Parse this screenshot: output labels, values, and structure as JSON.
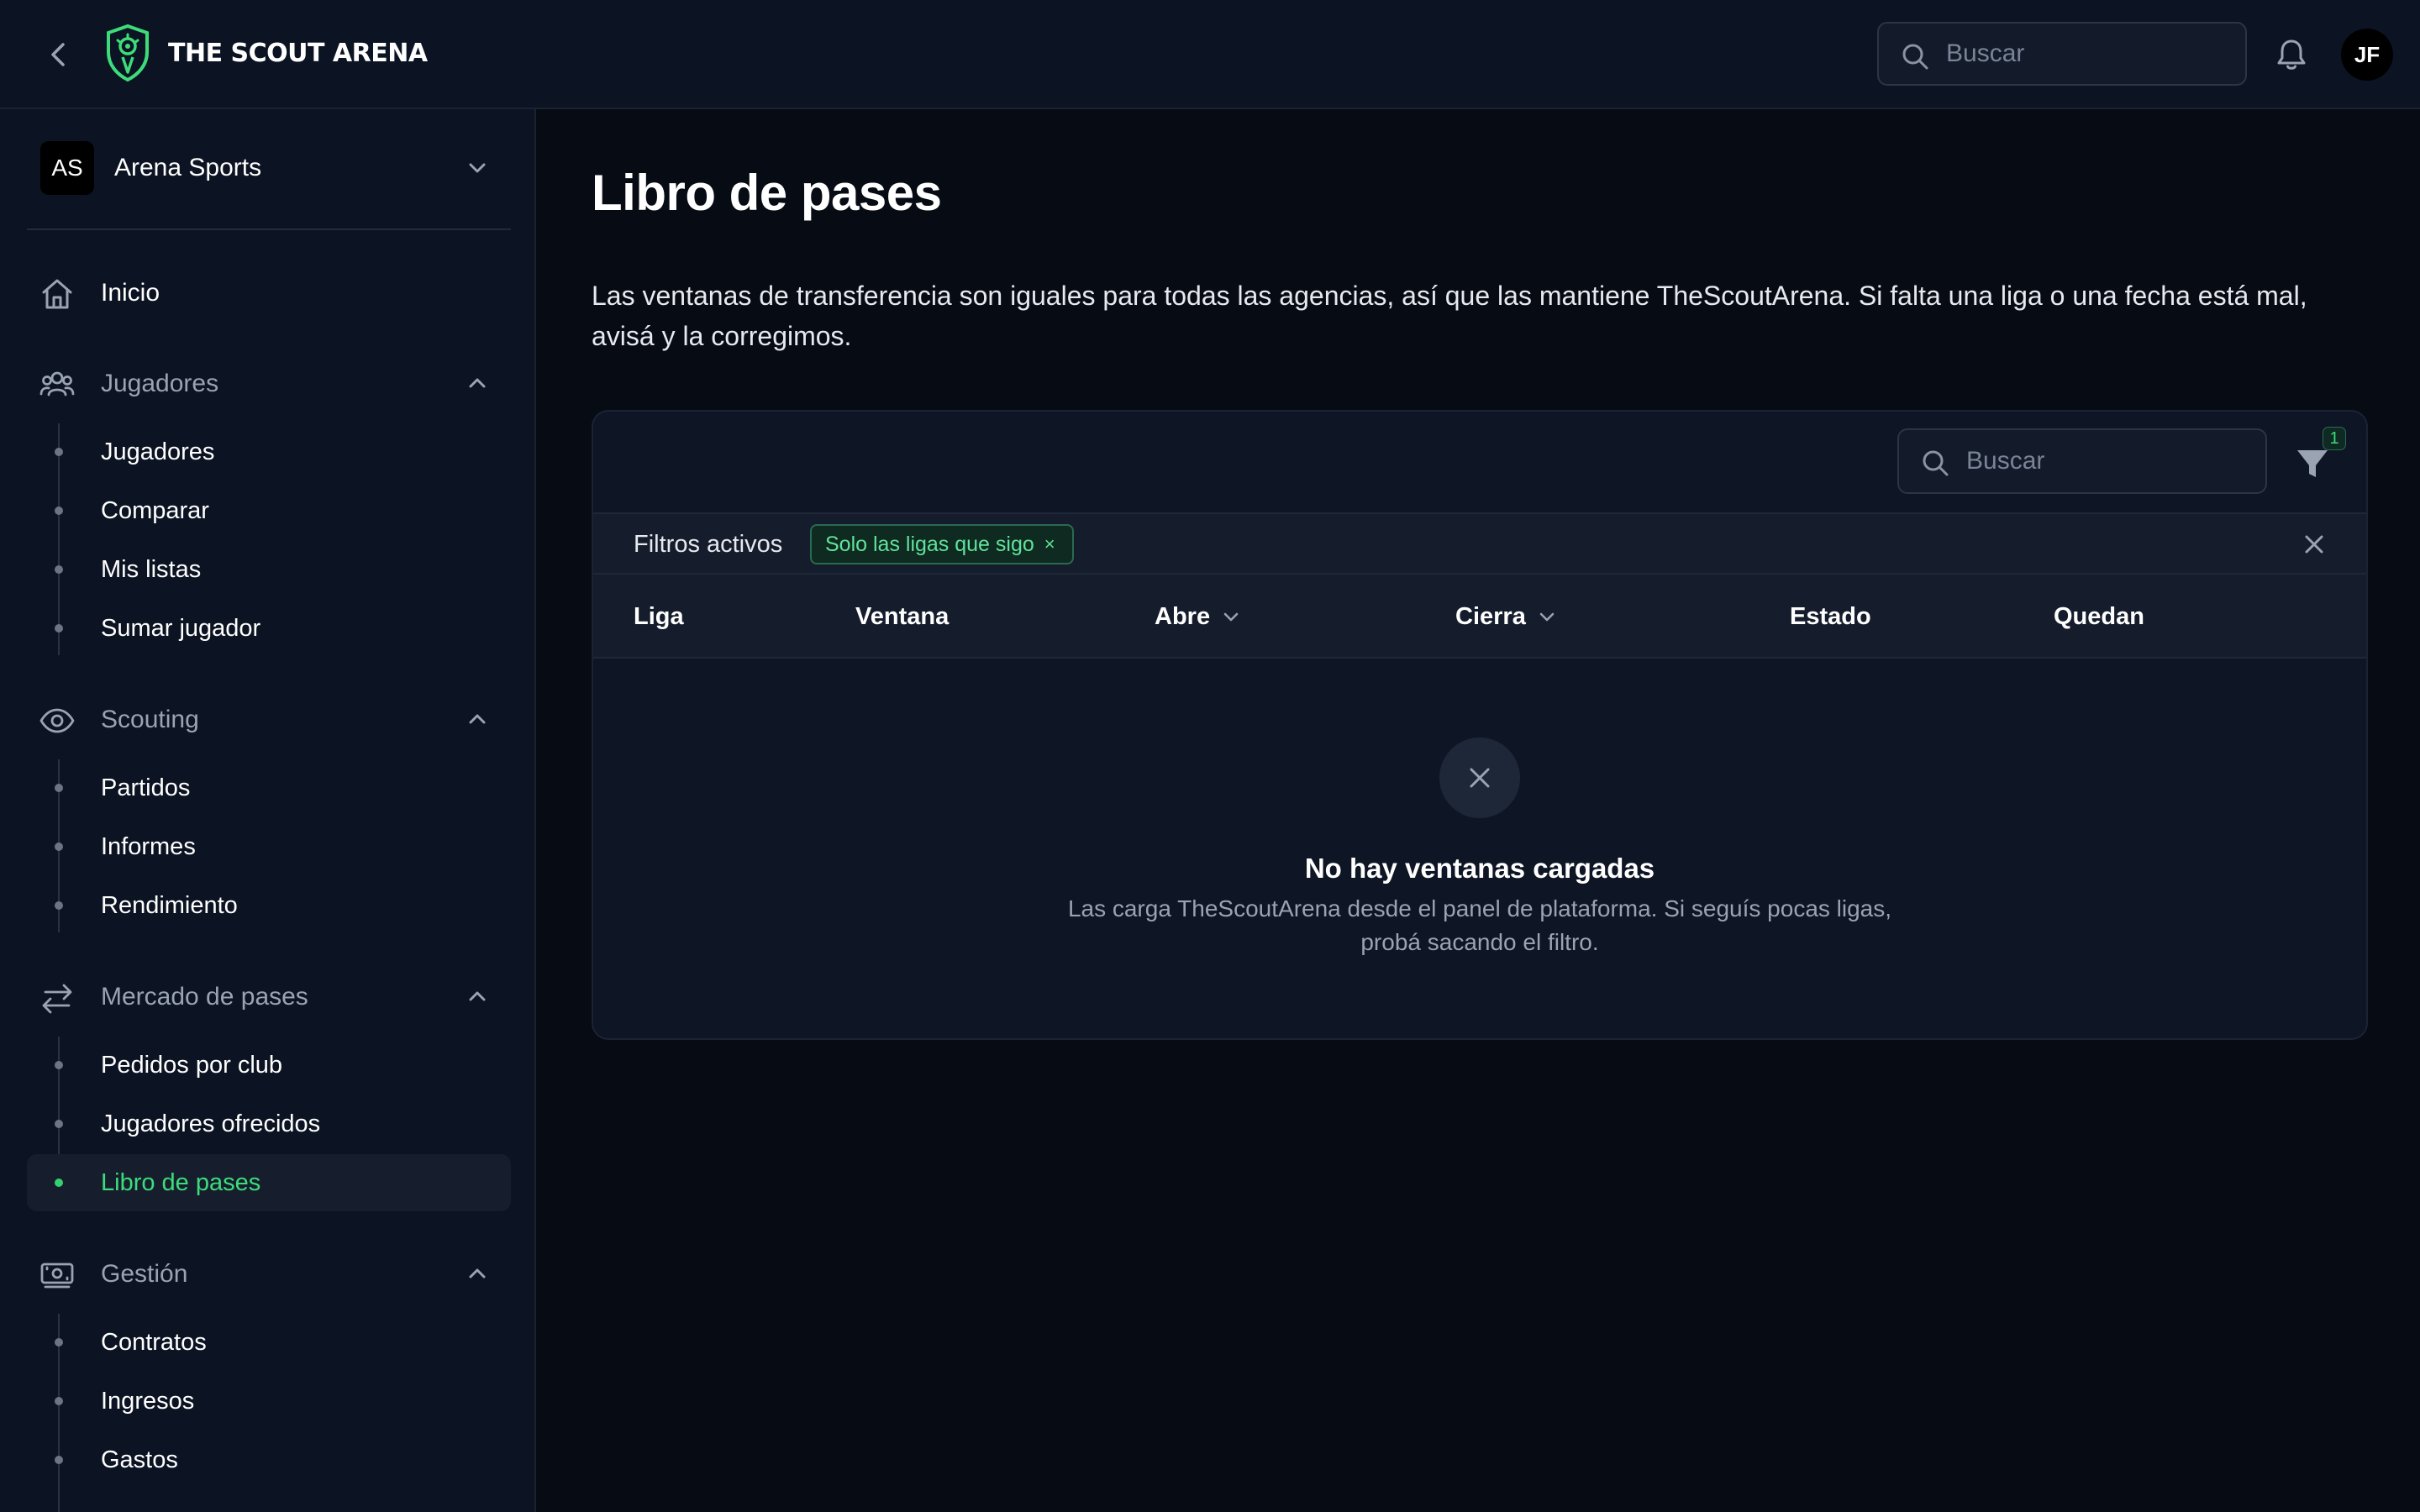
{
  "header": {
    "brand": "THE SCOUT ARENA",
    "search_placeholder": "Buscar",
    "user_initials": "JF"
  },
  "sidebar": {
    "org": {
      "initials": "AS",
      "name": "Arena Sports"
    },
    "home": "Inicio",
    "groups": [
      {
        "label": "Jugadores",
        "items": [
          "Jugadores",
          "Comparar",
          "Mis listas",
          "Sumar jugador"
        ]
      },
      {
        "label": "Scouting",
        "items": [
          "Partidos",
          "Informes",
          "Rendimiento"
        ]
      },
      {
        "label": "Mercado de pases",
        "items": [
          "Pedidos por club",
          "Jugadores ofrecidos",
          "Libro de pases"
        ]
      },
      {
        "label": "Gestión",
        "items": [
          "Contratos",
          "Ingresos",
          "Gastos"
        ]
      }
    ],
    "active_item": "Libro de pases"
  },
  "main": {
    "title": "Libro de pases",
    "description": "Las ventanas de transferencia son iguales para todas las agencias, así que las mantiene TheScoutArena. Si falta una liga o una fecha está mal, avisá y la corregimos.",
    "search_placeholder": "Buscar",
    "filter_count": "1",
    "active_filters_label": "Filtros activos",
    "active_filter_chip": "Solo las ligas que sigo",
    "chip_remove": "×",
    "columns": [
      "Liga",
      "Ventana",
      "Abre",
      "Cierra",
      "Estado",
      "Quedan"
    ],
    "empty": {
      "title": "No hay ventanas cargadas",
      "description": "Las carga TheScoutArena desde el panel de plataforma. Si seguís pocas ligas, probá sacando el filtro."
    }
  },
  "colors": {
    "background": "#060b14",
    "panel": "#0c1322",
    "accent": "#3ddc7a",
    "muted_text": "#9aa3b2"
  },
  "icons": {
    "back": "chevron-left-icon",
    "logo": "shield-logo-icon",
    "search": "search-icon",
    "notifications": "bell-icon",
    "home": "home-icon",
    "players": "users-icon",
    "scouting": "eye-icon",
    "market": "arrows-swap-icon",
    "management": "money-icon",
    "filter": "filter-icon",
    "close": "close-icon"
  }
}
